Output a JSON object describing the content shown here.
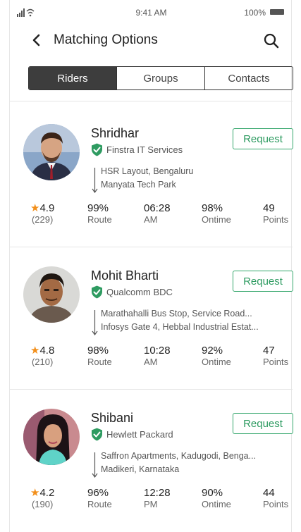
{
  "status_bar": {
    "time": "9:41 AM",
    "battery": "100%"
  },
  "header": {
    "title": "Matching Options"
  },
  "tabs": [
    {
      "label": "Riders",
      "active": true
    },
    {
      "label": "Groups",
      "active": false
    },
    {
      "label": "Contacts",
      "active": false
    }
  ],
  "colors": {
    "accent": "#2e9b61",
    "star": "#f28f1b",
    "tab_active": "#3d3d3d"
  },
  "riders": [
    {
      "name": "Shridhar",
      "company": "Finstra IT Services",
      "request_label": "Request",
      "from": "HSR Layout, Bengaluru",
      "to": "Manyata Tech Park",
      "rating": "4.9",
      "reviews": "(229)",
      "route_match": "99%",
      "route_label": "Route",
      "time": "06:28",
      "meridiem": "AM",
      "ontime": "98%",
      "ontime_label": "Ontime",
      "points": "49",
      "points_label": "Points"
    },
    {
      "name": "Mohit Bharti",
      "company": "Qualcomm BDC",
      "request_label": "Request",
      "from": "Marathahalli Bus Stop, Service Road...",
      "to": "Infosys Gate 4, Hebbal Industrial Estat...",
      "rating": "4.8",
      "reviews": "(210)",
      "route_match": "98%",
      "route_label": "Route",
      "time": "10:28",
      "meridiem": "AM",
      "ontime": "92%",
      "ontime_label": "Ontime",
      "points": "47",
      "points_label": "Points"
    },
    {
      "name": "Shibani",
      "company": "Hewlett Packard",
      "request_label": "Request",
      "from": "Saffron Apartments, Kadugodi, Benga...",
      "to": "Madikeri, Karnataka",
      "rating": "4.2",
      "reviews": "(190)",
      "route_match": "96%",
      "route_label": "Route",
      "time": "12:28",
      "meridiem": "PM",
      "ontime": "90%",
      "ontime_label": "Ontime",
      "points": "44",
      "points_label": "Points"
    }
  ]
}
